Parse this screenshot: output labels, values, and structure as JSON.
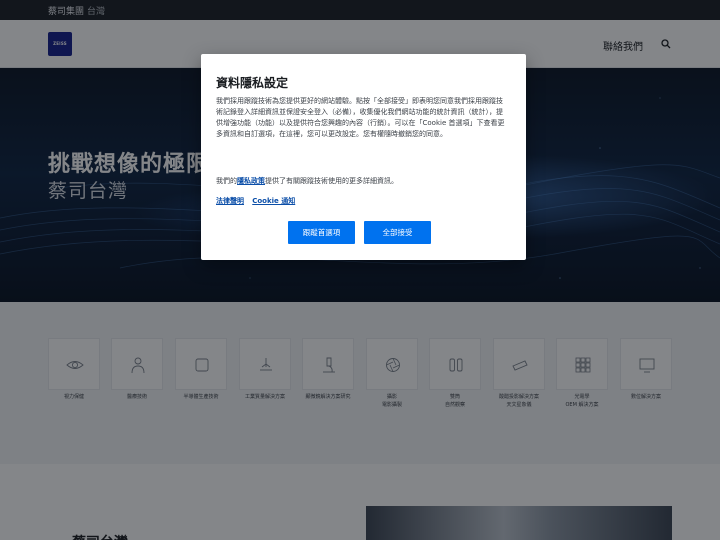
{
  "topbar": {
    "brand": "蔡司集團",
    "region": "台灣"
  },
  "header": {
    "logo_text": "ZEISS",
    "contact": "聯絡我們",
    "search_icon": "search-icon"
  },
  "hero": {
    "title": "挑戰想像的極限",
    "subtitle": "蔡司台灣"
  },
  "categories": [
    {
      "line1": "視力保健",
      "line2": "",
      "icon": "eye-icon"
    },
    {
      "line1": "醫療技術",
      "line2": "",
      "icon": "doctor-icon"
    },
    {
      "line1": "半導體生產技術",
      "line2": "",
      "icon": "wafer-icon"
    },
    {
      "line1": "工業質量解決方案",
      "line2": "",
      "icon": "measure-icon"
    },
    {
      "line1": "顯微鏡解決方案研究",
      "line2": "",
      "icon": "microscope-icon"
    },
    {
      "line1": "攝影",
      "line2": "電影攝製",
      "icon": "aperture-icon"
    },
    {
      "line1": "雙筒",
      "line2": "自然觀察",
      "icon": "binoculars-icon"
    },
    {
      "line1": "酸醋投影解決方案",
      "line2": "天文星象儀",
      "icon": "telescope-icon"
    },
    {
      "line1": "光電學",
      "line2": "OEM 解決方案",
      "icon": "grid-icon"
    },
    {
      "line1": "數位解決方案",
      "line2": "",
      "icon": "monitor-icon"
    }
  ],
  "bottom": {
    "title": "蔡司台灣"
  },
  "modal": {
    "title": "資料隱私設定",
    "body": "我們採用跟蹤技術為您提供更好的網站體驗。點按「全部接受」即表明您同意我們採用跟蹤技術記錄登入詳細資訊並保證安全登入（必備），收集優化我們網站功能的統計資訊（統計），提供增強功能（功能）以及提供符合您興趣的內容（行銷）。可以在「Cookie 首選項」下查看更多資訊和自訂選項，在這裡，您可以更改設定。您有權隨時撤銷您的同意。",
    "note_prefix": "我們的",
    "note_link": "隱私政策",
    "note_suffix": "提供了有關跟蹤技術使用的更多詳細資訊。",
    "link_legal": "法律聲明",
    "link_cookie": "Cookie 通知",
    "btn_preferences": "跟蹤首選項",
    "btn_accept_all": "全部接受"
  },
  "colors": {
    "accent": "#0072ef",
    "link": "#0b4ea8",
    "brand": "#141e8c",
    "topbar": "#1b1f24"
  }
}
